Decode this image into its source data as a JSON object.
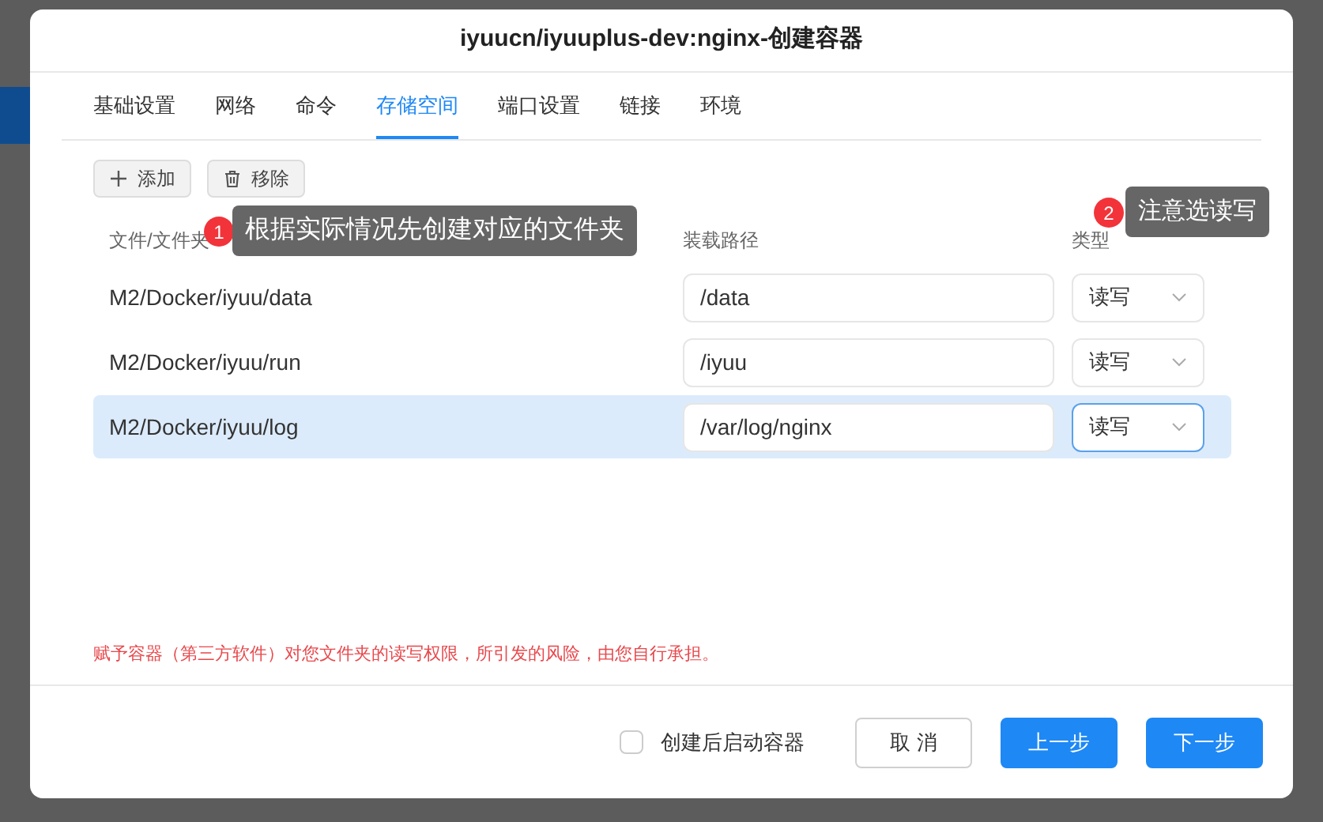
{
  "title": "iyuucn/iyuuplus-dev:nginx-创建容器",
  "tabs": [
    {
      "label": "基础设置",
      "selected": false
    },
    {
      "label": "网络",
      "selected": false
    },
    {
      "label": "命令",
      "selected": false
    },
    {
      "label": "存储空间",
      "selected": true
    },
    {
      "label": "端口设置",
      "selected": false
    },
    {
      "label": "链接",
      "selected": false
    },
    {
      "label": "环境",
      "selected": false
    }
  ],
  "toolbar": [
    {
      "kind": "add",
      "label": "添加"
    },
    {
      "kind": "remove",
      "label": "移除"
    }
  ],
  "columns": [
    "文件/文件夹",
    "装载路径",
    "类型"
  ],
  "rows": [
    {
      "folder": "M2/Docker/iyuu/data",
      "mount_path": "/data",
      "type": "读写",
      "selected": false
    },
    {
      "folder": "M2/Docker/iyuu/run",
      "mount_path": "/iyuu",
      "type": "读写",
      "selected": false
    },
    {
      "folder": "M2/Docker/iyuu/log",
      "mount_path": "/var/log/nginx",
      "type": "读写",
      "selected": true
    }
  ],
  "annotations": [
    {
      "number": "1",
      "text": "根据实际情况先创建对应的文件夹"
    },
    {
      "number": "2",
      "text": "注意选读写"
    }
  ],
  "warning": "赋予容器（第三方软件）对您文件夹的读写权限，所引发的风险，由您自行承担。",
  "start_after_create": {
    "label": "创建后启动容器",
    "checked": false
  },
  "buttons": [
    {
      "kind": "secondary",
      "label": "取 消"
    },
    {
      "kind": "primary",
      "label": "上一步"
    },
    {
      "kind": "primary",
      "label": "下一步"
    }
  ]
}
